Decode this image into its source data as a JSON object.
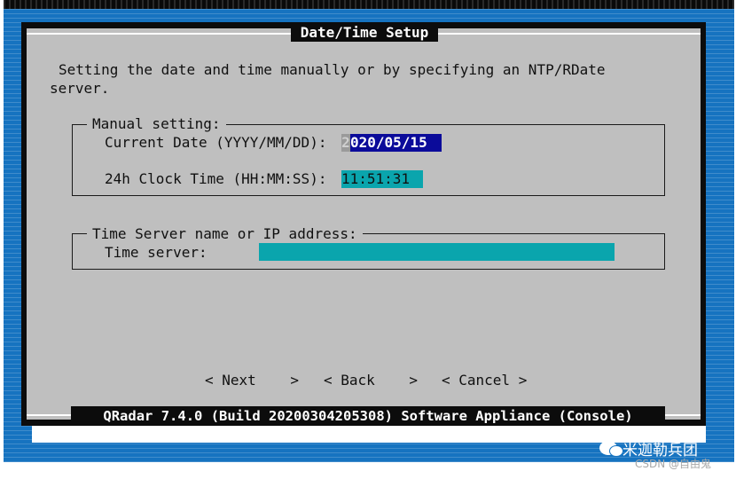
{
  "dialog": {
    "title": "Date/Time Setup",
    "description_line1": "Setting the date and time manually or by specifying an NTP/RDate",
    "description_line2": "server.",
    "footer": "QRadar 7.4.0 (Build 20200304205308) Software Appliance (Console)"
  },
  "manual": {
    "legend": "Manual setting:",
    "date_label": "Current Date (YYYY/MM/DD):",
    "date_cursor_char": "2",
    "date_value_rest": "020/05/15",
    "time_label": "24h Clock Time (HH:MM:SS):",
    "time_value": "11:51:31"
  },
  "server": {
    "legend": "Time Server name or IP address:",
    "label": "Time server:",
    "value": ""
  },
  "buttons": {
    "next": "< Next    >",
    "back": "< Back    >",
    "cancel": "< Cancel >"
  },
  "watermark": {
    "brand": "米迦勒兵团",
    "csdn": "CSDN @自由鬼"
  },
  "colors": {
    "background": "#1673c0",
    "dialog": "#bfbfbf",
    "date_field": "#0b0b9a",
    "cyan_field": "#0aa5ad"
  }
}
